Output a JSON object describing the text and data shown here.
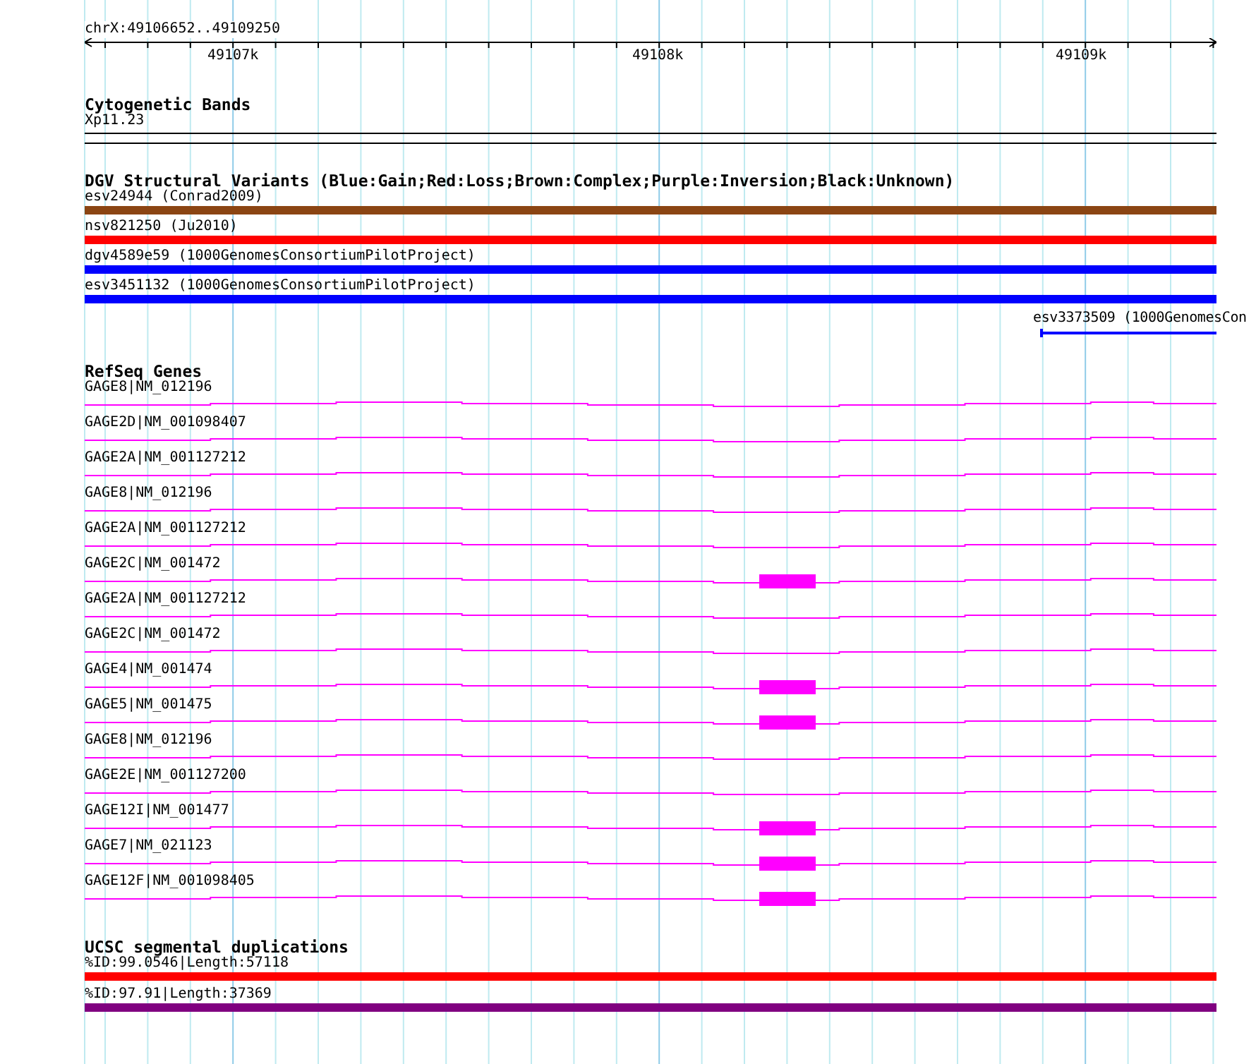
{
  "ruler": {
    "region": "chrX:49106652..49109250",
    "ticks": [
      "49107k",
      "49108k",
      "49109k"
    ]
  },
  "cytogenetic_bands": {
    "title": "Cytogenetic Bands",
    "band": "Xp11.23"
  },
  "dgv": {
    "title": "DGV Structural Variants (Blue:Gain;Red:Loss;Brown:Complex;Purple:Inversion;Black:Unknown)",
    "items": [
      {
        "label": "esv24944 (Conrad2009)",
        "color": "#8b4513",
        "kind": "full"
      },
      {
        "label": "nsv821250 (Ju2010)",
        "color": "#ff0000",
        "kind": "full"
      },
      {
        "label": "dgv4589e59 (1000GenomesConsortiumPilotProject)",
        "color": "#0000ff",
        "kind": "full"
      },
      {
        "label": "esv3451132 (1000GenomesConsortiumPilotProject)",
        "color": "#0000ff",
        "kind": "full"
      },
      {
        "label": "esv3373509 (1000GenomesCon",
        "color": "#0000ff",
        "kind": "partial"
      }
    ]
  },
  "refseq": {
    "title": "RefSeq Genes",
    "genes": [
      {
        "label": "GAGE8|NM_012196",
        "exon": false
      },
      {
        "label": "GAGE2D|NM_001098407",
        "exon": false
      },
      {
        "label": "GAGE2A|NM_001127212",
        "exon": false
      },
      {
        "label": "GAGE8|NM_012196",
        "exon": false
      },
      {
        "label": "GAGE2A|NM_001127212",
        "exon": false
      },
      {
        "label": "GAGE2C|NM_001472",
        "exon": true
      },
      {
        "label": "GAGE2A|NM_001127212",
        "exon": false
      },
      {
        "label": "GAGE2C|NM_001472",
        "exon": false
      },
      {
        "label": "GAGE4|NM_001474",
        "exon": true
      },
      {
        "label": "GAGE5|NM_001475",
        "exon": true
      },
      {
        "label": "GAGE8|NM_012196",
        "exon": false
      },
      {
        "label": "GAGE2E|NM_001127200",
        "exon": false
      },
      {
        "label": "GAGE12I|NM_001477",
        "exon": true
      },
      {
        "label": "GAGE7|NM_021123",
        "exon": true
      },
      {
        "label": "GAGE12F|NM_001098405",
        "exon": true
      }
    ]
  },
  "segmental_duplications": {
    "title": "UCSC segmental duplications",
    "items": [
      {
        "label": "%ID:99.0546|Length:57118",
        "color": "#ff0000"
      },
      {
        "label": "%ID:97.91|Length:37369",
        "color": "#800080"
      }
    ]
  }
}
